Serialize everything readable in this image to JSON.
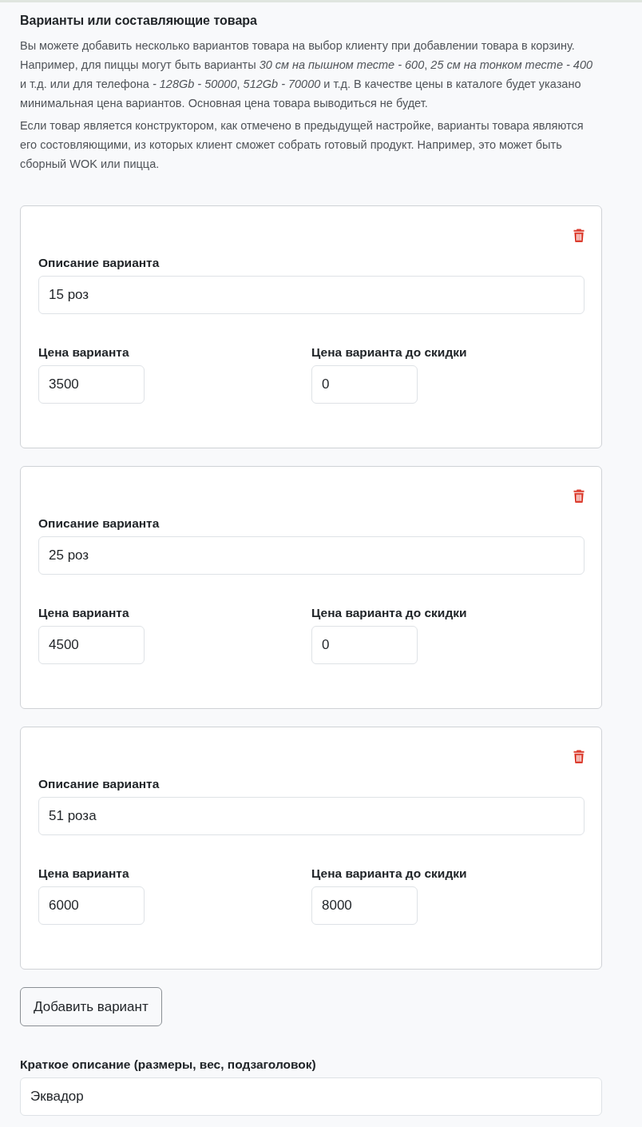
{
  "section": {
    "title": "Варианты или составляющие товара",
    "paragraphs": [
      "Вы можете добавить несколько вариантов товара на выбор клиенту при добавлении товара в корзину. Например, для пиццы могут быть варианты *30 см на пышном тесте - 600*, *25 см на тонком тесте - 400* и т.д. или для телефона *- 128Gb - 50000*, *512Gb - 70000* и т.д. В качестве цены в каталоге будет указано минимальная цена вариантов. Основная цена товара выводиться не будет.",
      "Если товар является конструктором, как отмечено в предыдущей настройке, варианты товара являются его состовляющими, из которых клиент сможет собрать готовый продукт. Например, это может быть сборный WOK или пицца."
    ]
  },
  "variants": [
    {
      "description_label": "Описание варианта",
      "description": "15 роз",
      "price_label": "Цена варианта",
      "price": "3500",
      "old_price_label": "Цена варианта до скидки",
      "old_price": "0"
    },
    {
      "description_label": "Описание варианта",
      "description": "25 роз",
      "price_label": "Цена варианта",
      "price": "4500",
      "old_price_label": "Цена варианта до скидки",
      "old_price": "0"
    },
    {
      "description_label": "Описание варианта",
      "description": "51 роза",
      "price_label": "Цена варианта",
      "price": "6000",
      "old_price_label": "Цена варианта до скидки",
      "old_price": "8000"
    }
  ],
  "add_button": "Добавить вариант",
  "short_description": {
    "label": "Краткое описание (размеры, вес, подзаголовок)",
    "value": "Эквадор"
  }
}
